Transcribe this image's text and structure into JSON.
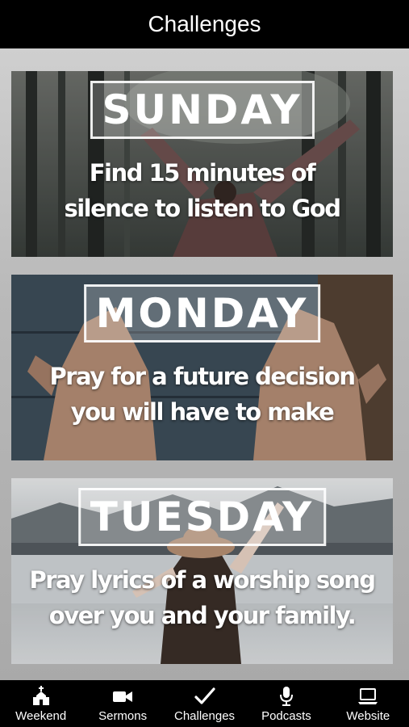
{
  "header": {
    "title": "Challenges"
  },
  "cards": [
    {
      "day": "SUNDAY",
      "line1": "Find 15 minutes of",
      "line2": "silence to listen to God",
      "scene": "person-raising-arms-in-forest"
    },
    {
      "day": "MONDAY",
      "line1": "Pray for a future decision",
      "line2": "you will have to make",
      "scene": "open-palms-over-wood"
    },
    {
      "day": "TUESDAY",
      "line1": "Pray lyrics of a worship song",
      "line2": "over you and your family.",
      "scene": "woman-in-hat-by-lake"
    }
  ],
  "tabbar": {
    "items": [
      {
        "label": "Weekend",
        "icon": "church-icon"
      },
      {
        "label": "Sermons",
        "icon": "video-camera-icon"
      },
      {
        "label": "Challenges",
        "icon": "checkmark-icon"
      },
      {
        "label": "Podcasts",
        "icon": "microphone-icon"
      },
      {
        "label": "Website",
        "icon": "laptop-icon"
      }
    ]
  },
  "colors": {
    "background": "#000000",
    "text": "#ffffff",
    "content_bg": "#bdbdbd"
  }
}
